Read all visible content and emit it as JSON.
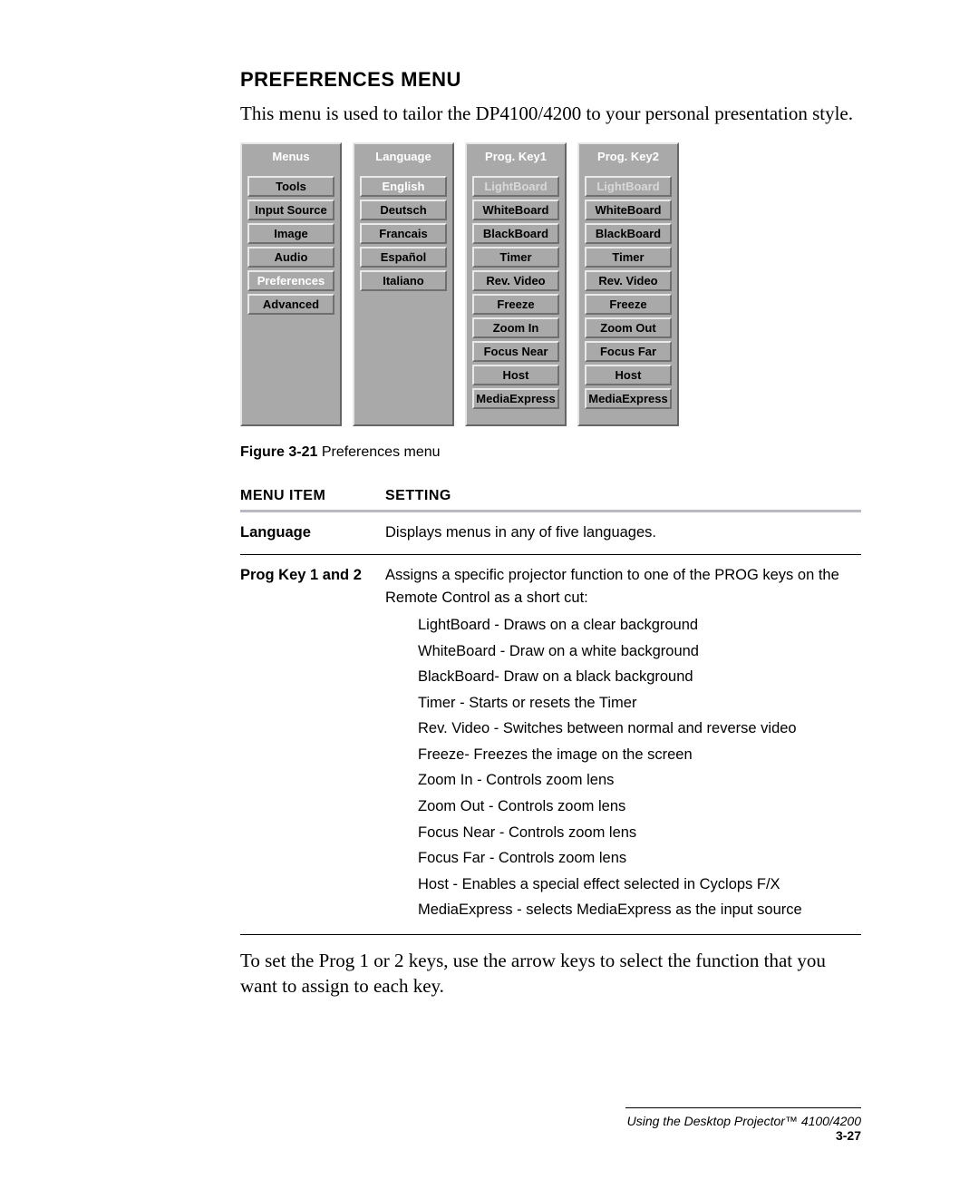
{
  "heading": "PREFERENCES MENU",
  "intro": "This menu is used to tailor the DP4100/4200 to your personal presentation style.",
  "menu_cols": [
    {
      "header": "Menus",
      "items": [
        "Tools",
        "Input Source",
        "Image",
        "Audio",
        "Preferences",
        "Advanced"
      ],
      "selected_index": 4
    },
    {
      "header": "Language",
      "items": [
        "English",
        "Deutsch",
        "Francais",
        "Español",
        "Italiano"
      ],
      "selected_index": 0
    },
    {
      "header": "Prog. Key1",
      "items": [
        "LightBoard",
        "WhiteBoard",
        "BlackBoard",
        "Timer",
        "Rev. Video",
        "Freeze",
        "Zoom In",
        "Focus Near",
        "Host",
        "MediaExpress"
      ],
      "selected_index": 0
    },
    {
      "header": "Prog. Key2",
      "items": [
        "LightBoard",
        "WhiteBoard",
        "BlackBoard",
        "Timer",
        "Rev. Video",
        "Freeze",
        "Zoom Out",
        "Focus Far",
        "Host",
        "MediaExpress"
      ],
      "selected_index": 0
    }
  ],
  "figure": {
    "label": "Figure 3-21",
    "caption": "Preferences menu"
  },
  "table": {
    "headers": {
      "item": "MENU ITEM",
      "setting": "SETTING"
    },
    "rows": [
      {
        "item": "Language",
        "setting": "Displays menus in any of five languages."
      },
      {
        "item": "Prog Key 1 and 2",
        "setting": "Assigns a specific projector function to one of the PROG keys on the Remote Control as a short cut:",
        "sub": [
          "LightBoard - Draws on a clear background",
          "WhiteBoard - Draw on a white background",
          "BlackBoard- Draw on a black background",
          "Timer - Starts or resets the Timer",
          "Rev. Video - Switches between normal and reverse video",
          "Freeze- Freezes the image on the screen",
          "Zoom In - Controls zoom lens",
          "Zoom Out - Controls zoom lens",
          "Focus Near - Controls zoom lens",
          "Focus Far - Controls zoom lens",
          "Host - Enables a special effect selected in Cyclops F/X",
          "MediaExpress - selects MediaExpress as the input source"
        ]
      }
    ]
  },
  "body_after_table": "To set the Prog 1 or 2 keys, use the arrow keys to select the function that you want to assign to each key.",
  "footer": {
    "title": "Using the Desktop Projector™ 4100/4200",
    "page": "3-27"
  }
}
